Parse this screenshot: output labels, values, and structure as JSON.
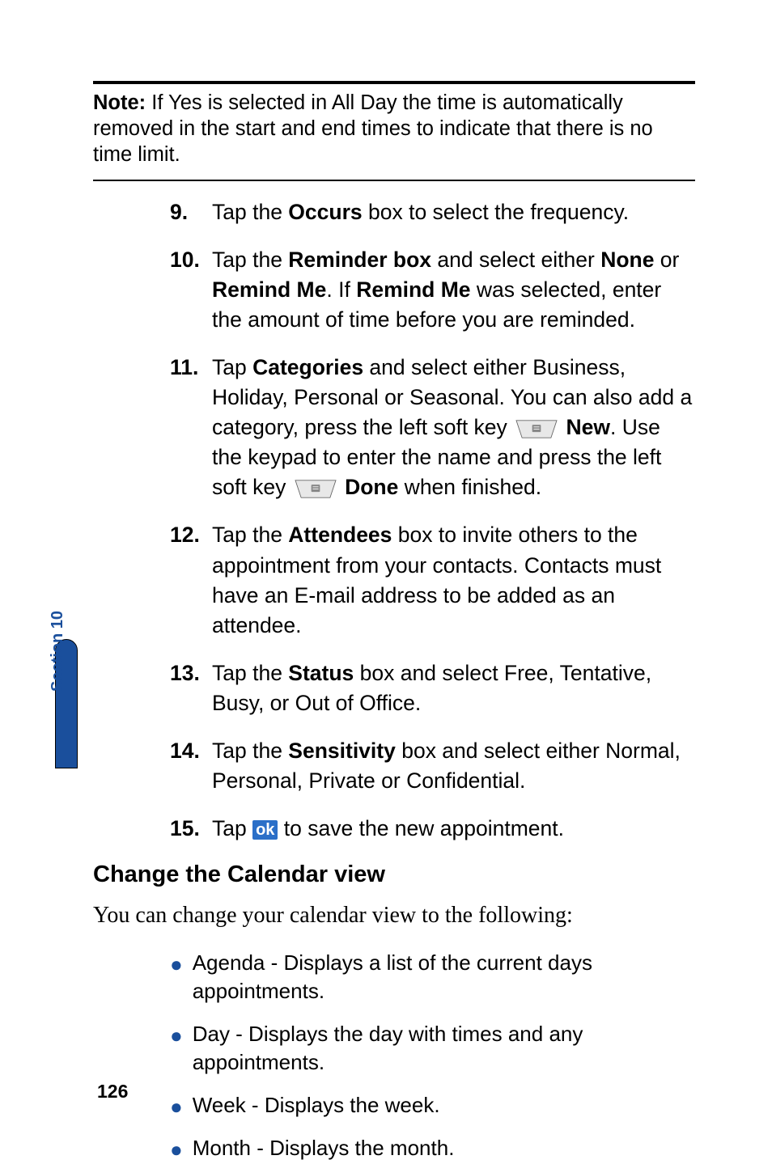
{
  "note": {
    "label": "Note:",
    "text": "If Yes is selected in All Day the time is automatically removed in the start and end times to indicate that there is no time limit."
  },
  "steps": {
    "s9": {
      "num": "9.",
      "t1": "Tap the ",
      "b1": "Occurs",
      "t2": " box to select the frequency."
    },
    "s10": {
      "num": "10.",
      "t1": "Tap the ",
      "b1": "Reminder box",
      "t2": " and select either ",
      "b2": "None",
      "t3": " or ",
      "b3": "Remind Me",
      "t4": ". If ",
      "b4": "Remind Me",
      "t5": " was selected, enter the amount of time before you are reminded."
    },
    "s11": {
      "num": "11.",
      "t1": "Tap ",
      "b1": "Categories",
      "t2": " and select either Business, Holiday, Personal or Seasonal. You can also add a category, press the left soft key ",
      "b2": "New",
      "t3": ". Use the keypad to enter the name and press the left soft key ",
      "b3": "Done",
      "t4": " when finished."
    },
    "s12": {
      "num": "12.",
      "t1": "Tap the ",
      "b1": "Attendees",
      "t2": " box to invite others to the appointment from your contacts. Contacts must have an E-mail address to be added as an attendee."
    },
    "s13": {
      "num": "13.",
      "t1": "Tap the ",
      "b1": "Status",
      "t2": " box and select Free, Tentative, Busy, or Out of Office."
    },
    "s14": {
      "num": "14.",
      "t1": "Tap the ",
      "b1": "Sensitivity",
      "t2": " box and select either Normal, Personal, Private or Confidential."
    },
    "s15": {
      "num": "15.",
      "t1": "Tap ",
      "t2": " to save the new appointment."
    }
  },
  "heading": "Change the Calendar view",
  "intro": "You can change your calendar view to the following:",
  "bullets": {
    "b1": "Agenda - Displays a list of the current days appointments.",
    "b2": "Day - Displays the day with times and any appointments.",
    "b3": "Week - Displays the week.",
    "b4": "Month - Displays the month."
  },
  "sectionTab": "Section 10",
  "pageNum": "126",
  "okLabel": "ok"
}
